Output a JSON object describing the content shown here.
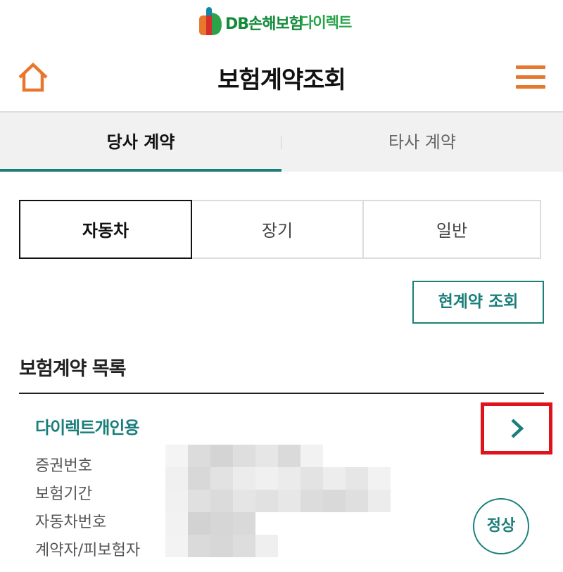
{
  "brand": {
    "name": "DB손해보험",
    "sub": "다이렉트",
    "colors": {
      "green": "#138a3a",
      "orange": "#e8772e",
      "teal": "#1a7f7a"
    }
  },
  "header": {
    "title": "보험계약조회",
    "home_icon": "home-icon",
    "menu_icon": "hamburger-menu-icon"
  },
  "company_tabs": [
    {
      "label": "당사 계약",
      "active": true
    },
    {
      "label": "타사 계약",
      "active": false
    }
  ],
  "product_types": [
    {
      "label": "자동차",
      "selected": true
    },
    {
      "label": "장기",
      "selected": false
    },
    {
      "label": "일반",
      "selected": false
    }
  ],
  "current_contract_button": "현계약 조회",
  "list": {
    "title": "보험계약 목록",
    "items": [
      {
        "product": "다이렉트개인용",
        "fields": [
          "증권번호",
          "보험기간",
          "자동차번호",
          "계약자/피보험자"
        ],
        "status": "정상",
        "detail_icon": "chevron-right-icon"
      }
    ]
  }
}
